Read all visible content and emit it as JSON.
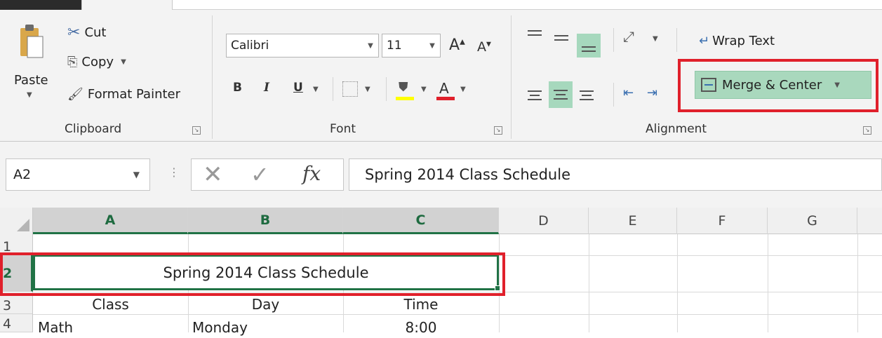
{
  "clipboard": {
    "paste_label": "Paste",
    "cut_label": "Cut",
    "copy_label": "Copy",
    "format_painter_label": "Format Painter",
    "group_label": "Clipboard"
  },
  "font": {
    "name": "Calibri",
    "size": "11",
    "grow_label": "A",
    "shrink_label": "A",
    "bold_label": "B",
    "italic_label": "I",
    "underline_label": "U",
    "font_color_label": "A",
    "group_label": "Font"
  },
  "alignment": {
    "wrap_text_label": "Wrap Text",
    "merge_center_label": "Merge & Center",
    "group_label": "Alignment"
  },
  "formula_bar": {
    "name_box": "A2",
    "fx_label": "fx",
    "content": "Spring 2014 Class Schedule"
  },
  "sheet": {
    "columns": [
      "A",
      "B",
      "C",
      "D",
      "E",
      "F",
      "G"
    ],
    "rows": [
      "1",
      "2",
      "3",
      "4"
    ],
    "a2_merged": "Spring 2014 Class Schedule",
    "r3": [
      "Class",
      "Day",
      "Time"
    ],
    "r4": [
      "Math",
      "Monday",
      "8:00"
    ]
  },
  "colors": {
    "accent_green": "#217346",
    "highlight_red": "#e0202b",
    "active_fill": "#a9d8bd"
  }
}
